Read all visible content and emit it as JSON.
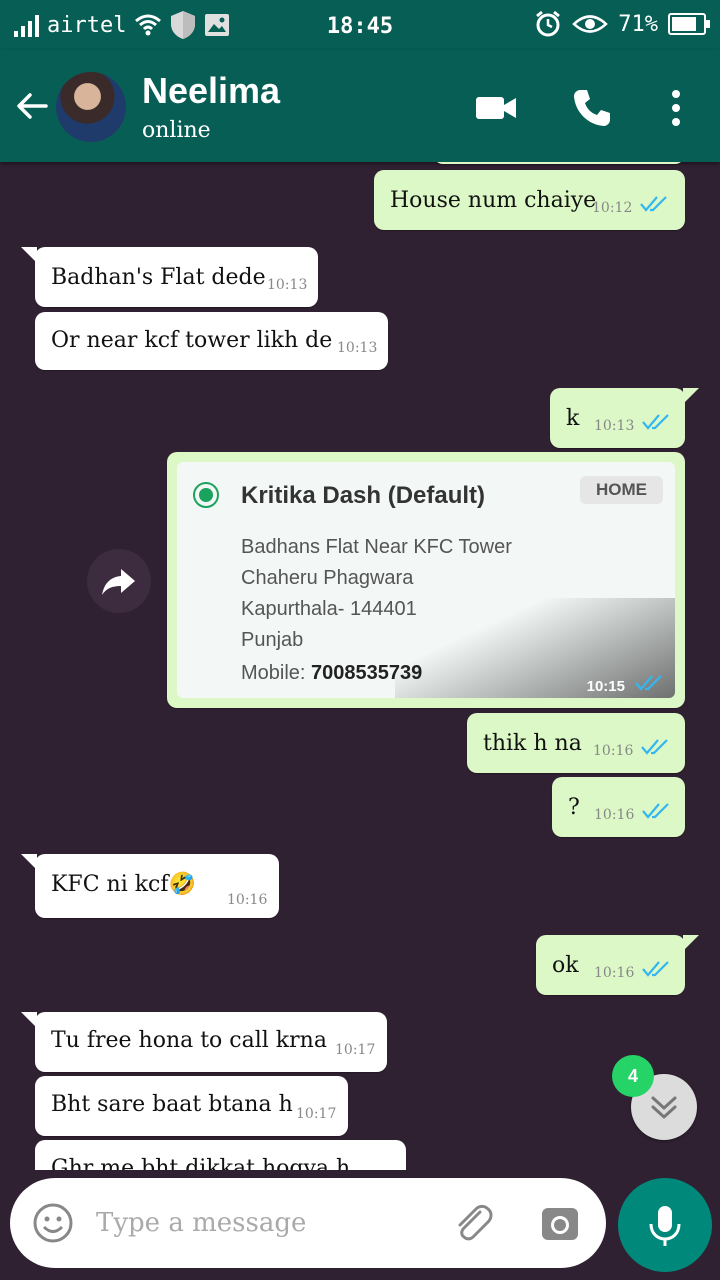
{
  "status_bar": {
    "carrier": "airtel",
    "time": "18:45",
    "battery": "71%"
  },
  "header": {
    "contact_name": "Neelima",
    "contact_status": "online"
  },
  "messages": [
    {
      "text": "House num chaiye",
      "time": "10:12"
    },
    {
      "text": "Badhan's Flat dede",
      "time": "10:13"
    },
    {
      "text": "Or near kcf tower likh de",
      "time": "10:13"
    },
    {
      "text": "k",
      "time": "10:13"
    },
    {
      "text": "thik h na",
      "time": "10:16"
    },
    {
      "text": "?",
      "time": "10:16"
    },
    {
      "text": "KFC ni kcf🤣",
      "time": "10:16"
    },
    {
      "text": "ok",
      "time": "10:16"
    },
    {
      "text": "Tu free hona to call krna",
      "time": "10:17"
    },
    {
      "text": "Bht sare baat btana h",
      "time": "10:17"
    },
    {
      "text": "Ghr me bht dikkat hogya h",
      "time": ""
    }
  ],
  "address_card": {
    "name": "Kritika Dash (Default)",
    "tag": "HOME",
    "line1": "Badhans Flat Near KFC Tower",
    "line2": "Chaheru Phagwara",
    "line3": "Kapurthala- 144401",
    "line4": "Punjab",
    "mobile_label": "Mobile:",
    "mobile": "7008535739",
    "time": "10:15"
  },
  "unread_count": "4",
  "input": {
    "placeholder": "Type a message"
  },
  "colors": {
    "header": "#075e54",
    "chat_bg": "#302132",
    "outgoing": "#dcf8c6",
    "incoming": "#ffffff",
    "tick_read": "#34b7f1",
    "fab": "#00897b",
    "badge": "#25d366"
  }
}
